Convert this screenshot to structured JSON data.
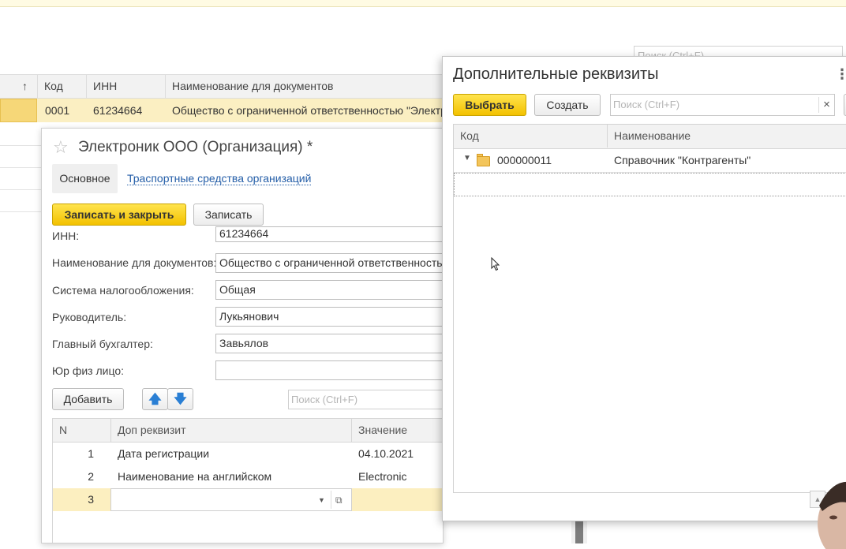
{
  "background_list": {
    "search_placeholder": "Поиск (Ctrl+F)",
    "columns": [
      "↑",
      "Код",
      "ИНН",
      "Наименование для документов"
    ],
    "row": {
      "code": "0001",
      "inn": "61234664",
      "name": "Общество с ограниченной ответственностью \"Электр"
    }
  },
  "org_form": {
    "title": "Электроник ООО (Организация) *",
    "tabs": {
      "main": "Основное",
      "vehicles": "Траспортные средства организаций"
    },
    "buttons": {
      "save_close": "Записать и закрыть",
      "save": "Записать",
      "add": "Добавить"
    },
    "fields": {
      "inn": {
        "label": "ИНН:",
        "value": "61234664"
      },
      "doc_name": {
        "label": "Наименование для документов:",
        "value": "Общество с ограниченной ответственностью"
      },
      "tax_system": {
        "label": "Система налогообложения:",
        "value": "Общая"
      },
      "director": {
        "label": "Руководитель:",
        "value": "Лукьянович"
      },
      "accountant": {
        "label": "Главный бухгалтер:",
        "value": "Завьялов"
      },
      "entity_type": {
        "label": "Юр физ лицо:",
        "value": ""
      }
    },
    "search_placeholder": "Поиск (Ctrl+F)",
    "table": {
      "headers": [
        "N",
        "Доп реквизит",
        "Значение"
      ],
      "rows": [
        {
          "n": "1",
          "attr": "Дата регистрации",
          "value": "04.10.2021"
        },
        {
          "n": "2",
          "attr": "Наименование на английском",
          "value": "Electronic"
        },
        {
          "n": "3",
          "attr": "",
          "value": ""
        }
      ]
    }
  },
  "dialog": {
    "title": "Дополнительные реквизиты",
    "buttons": {
      "select": "Выбрать",
      "create": "Создать"
    },
    "search_placeholder": "Поиск (Ctrl+F)",
    "clear_symbol": "×",
    "menu_symbol": "⋮",
    "headers": [
      "Код",
      "Наименование"
    ],
    "rows": [
      {
        "code": "000000011",
        "name": "Справочник \"Контрагенты\""
      }
    ]
  },
  "colors": {
    "accent_yellow": "#f6d778",
    "link_blue": "#245ea8",
    "arrow_blue": "#2a7fd4"
  }
}
